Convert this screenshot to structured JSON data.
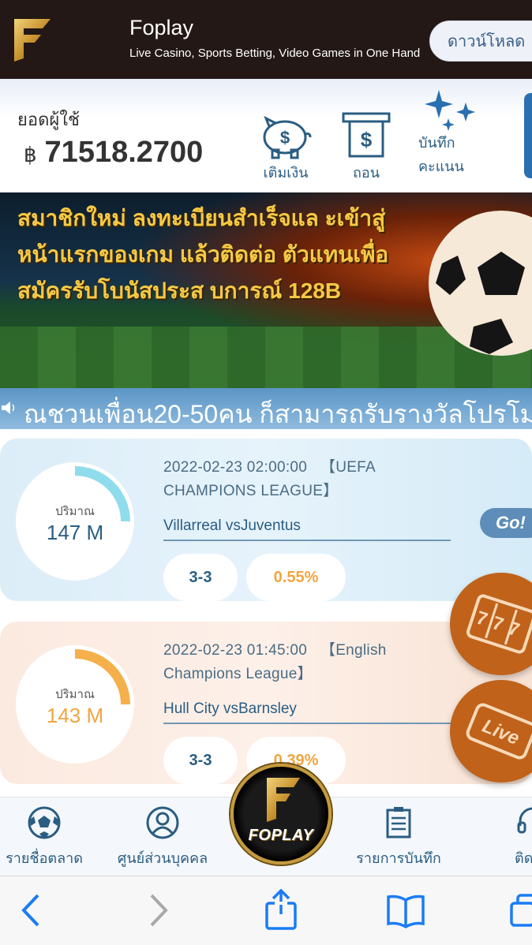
{
  "app_banner": {
    "title": "Foplay",
    "description": "Live Casino, Sports Betting, Video Games in One Hand",
    "download_label": "ดาวน์โหลด"
  },
  "account": {
    "balance_label": "ยอดผู้ใช้",
    "currency_symbol": "฿",
    "balance": "71518.2700",
    "actions": {
      "deposit": "เติมเงิน",
      "withdraw": "ถอน",
      "record_line1": "บันทึก",
      "record_line2": "คะแนน"
    }
  },
  "promo_banner": {
    "text": "สมาชิกใหม่ ลงทะเบียนสำเร็จแล ะเข้าสู่หน้าแรกของเกม แล้วติดต่อ ตัวแทนเพื่อสมัครรับโบนัสประส บการณ์ 128B"
  },
  "marquee": {
    "text": "ณชวนเพื่อน20-50คน ก็สามารถรับรางวัลโปรโม"
  },
  "matches": [
    {
      "volume_label": "ปริมาณ",
      "volume": "147 M",
      "gauge_fraction": 0.25,
      "gauge_color": "#8fdcec",
      "time": "2022-02-23 02:00:00",
      "league": "【UEFA CHAMPIONS LEAGUE】",
      "teams": "Villarreal vsJuventus",
      "score": "3-3",
      "odds": "0.55%",
      "go_label": "Go!"
    },
    {
      "volume_label": "ปริมาณ",
      "volume": "143 M",
      "gauge_fraction": 0.25,
      "gauge_color": "#f5b04c",
      "time": "2022-02-23 01:45:00",
      "league": "【English Champions League】",
      "teams": "Hull City vsBarnsley",
      "score": "3-3",
      "odds": "0.39%"
    }
  ],
  "floating": {
    "slot_icon": "slot-machine-777-icon",
    "slot_text": "777",
    "live_icon": "live-icon",
    "live_text": "Live"
  },
  "bottom_nav": {
    "market": "รายชื่อตลาด",
    "personal": "ศูนย์ส่วนบุคคล",
    "center_logo": "FOPLAY",
    "record": "รายการบันทึก",
    "contact": "ติดต่อ"
  },
  "colors": {
    "header_bg": "#231815",
    "primary_blue": "#2a5d82",
    "accent_orange": "#f2a540",
    "gold": "#c59a3c"
  }
}
